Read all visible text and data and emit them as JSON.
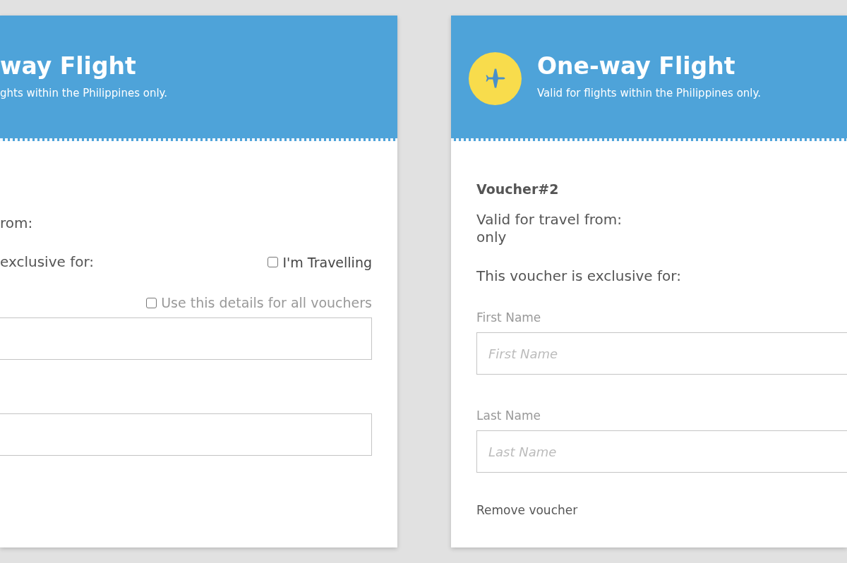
{
  "cards": [
    {
      "header": {
        "kind": "plain",
        "title": "way Flight",
        "subtitle": "ghts within the Philippines only."
      },
      "travel_from": "rom:",
      "exclusive_label": "exclusive for:",
      "travelling_checkbox": {
        "label": "I'm Travelling",
        "checked": false
      },
      "all_vouchers_checkbox": {
        "label": "Use this details for all vouchers",
        "checked": false
      },
      "fields": [
        {
          "kind": "text_input"
        },
        {
          "kind": "text_input"
        }
      ]
    },
    {
      "header": {
        "title": "One-way Flight",
        "subtitle": "Valid for flights within the Philippines only.",
        "kind": "with_icon"
      },
      "voucher_label": "Voucher#2",
      "travel_from": "Valid for travel from:",
      "travel_note": "only",
      "exclusive_label": "This voucher is exclusive for:",
      "fields": [
        {
          "kind": "text_input",
          "label": "First Name",
          "placeholder": "First Name"
        },
        {
          "kind": "text_input",
          "label": "Last Name",
          "placeholder": "Last Name"
        }
      ],
      "remove_link": "Remove voucher"
    }
  ]
}
